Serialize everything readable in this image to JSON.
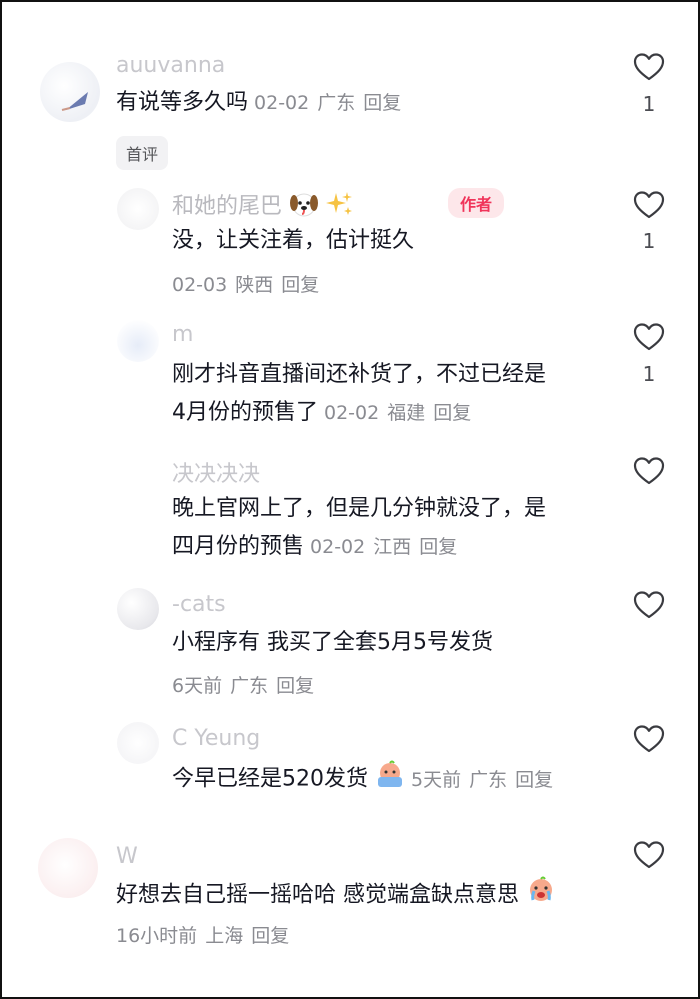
{
  "comments": [
    {
      "username": "auuvanna",
      "text": "有说等多久吗",
      "date": "02-02",
      "location": "广东",
      "reply_label": "回复",
      "badge": "首评",
      "likes": "1"
    }
  ],
  "replies": [
    {
      "username": "和她的尾巴",
      "author_tag": "作者",
      "text": "没，让关注着，估计挺久",
      "date": "02-03",
      "location": "陕西",
      "reply_label": "回复",
      "likes": "1"
    },
    {
      "username": "m",
      "text_line1": "刚才抖音直播间还补货了，不过已经是",
      "text_line2": "4月份的预售了",
      "date": "02-02",
      "location": "福建",
      "reply_label": "回复",
      "likes": "1"
    },
    {
      "username": "决决决决",
      "text_line1": "晚上官网上了，但是几分钟就没了，是",
      "text_line2": "四月份的预售",
      "date": "02-02",
      "location": "江西",
      "reply_label": "回复"
    },
    {
      "username": "-cats",
      "text": "小程序有 我买了全套5月5号发货",
      "date": "6天前",
      "location": "广东",
      "reply_label": "回复"
    },
    {
      "username": "C   Yeung",
      "text": "今早已经是520发货",
      "date": "5天前",
      "location": "广东",
      "reply_label": "回复"
    }
  ],
  "last_comment": {
    "username": "W",
    "text": "好想去自己摇一摇哈哈 感觉端盒缺点意思",
    "date": "16小时前",
    "location": "上海",
    "reply_label": "回复"
  },
  "colors": {
    "text": "#161823",
    "meta": "#8a8b91",
    "author_tag_bg": "#fde7ea",
    "author_tag_fg": "#f0345a"
  },
  "icons": {
    "like": "heart-outline-icon",
    "dog": "dog-face-emoji",
    "sparkles": "sparkles-emoji",
    "crying": "crying-face-emoji"
  }
}
